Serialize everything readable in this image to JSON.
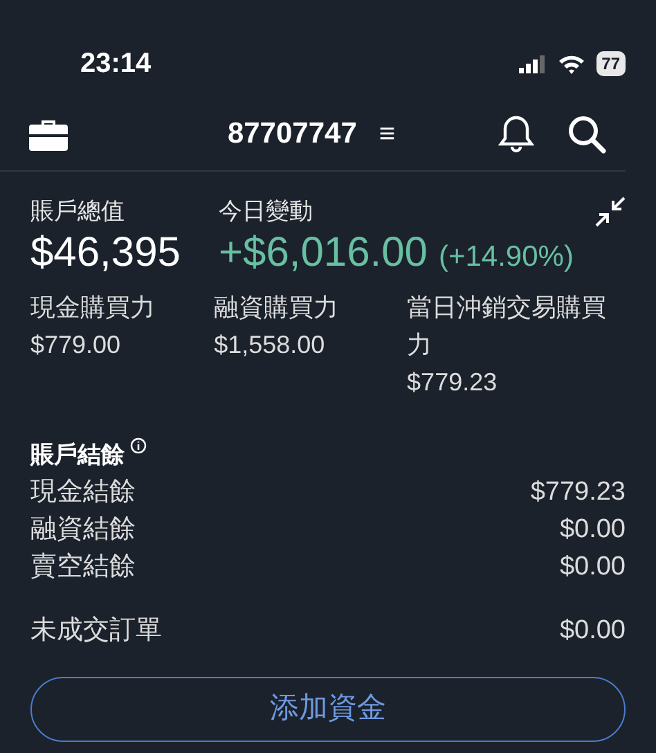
{
  "status_bar": {
    "time": "23:14",
    "battery": "77"
  },
  "header": {
    "account": "87707747",
    "menu_glyph": "≡"
  },
  "summary": {
    "total_label": "賬戶總值",
    "total_value": "$46,395",
    "change_label": "今日變動",
    "change_value": "+$6,016.00",
    "change_percent": "(+14.90%)"
  },
  "buying_power": [
    {
      "label": "現金購買力",
      "value": "$779.00"
    },
    {
      "label": "融資購買力",
      "value": "$1,558.00"
    },
    {
      "label": "當日沖銷交易購買力",
      "value": "$779.23"
    }
  ],
  "balances": {
    "title": "賬戶結餘",
    "rows": [
      {
        "label": "現金結餘",
        "value": "$779.23"
      },
      {
        "label": "融資結餘",
        "value": "$0.00"
      },
      {
        "label": "賣空結餘",
        "value": "$0.00"
      }
    ]
  },
  "open_orders": {
    "label": "未成交訂單",
    "value": "$0.00"
  },
  "add_funds_button": "添加資金"
}
